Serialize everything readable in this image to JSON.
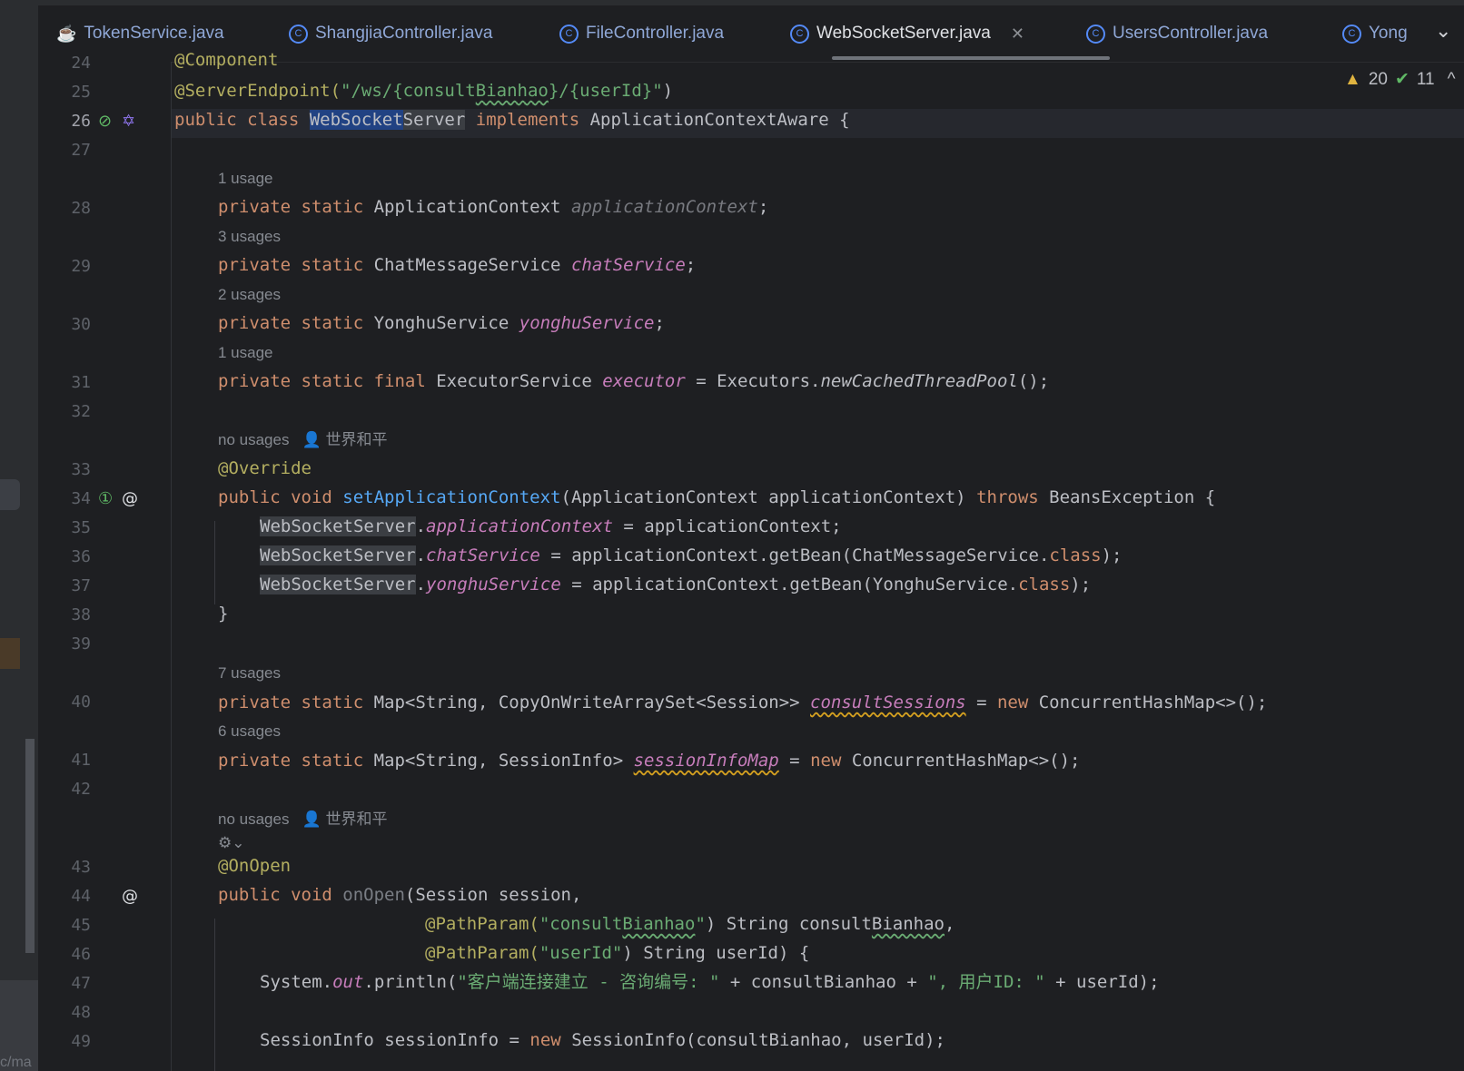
{
  "tabs": [
    {
      "label": "TokenService.java",
      "icon": "coffee-cup-icon"
    },
    {
      "label": "ShangjiaController.java",
      "icon": "class-icon"
    },
    {
      "label": "FileController.java",
      "icon": "class-icon"
    },
    {
      "label": "WebSocketServer.java",
      "icon": "class-icon",
      "active": true
    },
    {
      "label": "UsersController.java",
      "icon": "class-icon"
    },
    {
      "label": "Yong",
      "icon": "class-icon"
    }
  ],
  "inspection": {
    "warnings": "20",
    "ok": "11"
  },
  "sidebar_fragment": "c/ma",
  "line_numbers": {
    "l24": "24",
    "l25": "25",
    "l26": "26",
    "l27": "27",
    "l28": "28",
    "l29": "29",
    "l30": "30",
    "l31": "31",
    "l32": "32",
    "l33": "33",
    "l34": "34",
    "l35": "35",
    "l36": "36",
    "l37": "37",
    "l38": "38",
    "l39": "39",
    "l40": "40",
    "l41": "41",
    "l42": "42",
    "l43": "43",
    "l44": "44",
    "l45": "45",
    "l46": "46",
    "l47": "47",
    "l48": "48",
    "l49": "49"
  },
  "hints": {
    "h28": "1 usage",
    "h29": "3 usages",
    "h30": "2 usages",
    "h31": "1 usage",
    "h33": "no usages",
    "h40": "7 usages",
    "h41": "6 usages",
    "h43": "no usages",
    "author": "世界和平"
  },
  "code": {
    "l24_ann": "@Component",
    "l25_ann": "@ServerEndpoint(",
    "l25_str1": "\"/ws/{consult",
    "l25_str2": "Bianhao",
    "l25_str3": "}/{userId}\"",
    "l25_close": ")",
    "l26_kw": "public class ",
    "l26_sel": "WebSocket",
    "l26_ref": "Server",
    "l26_kw2": " implements ",
    "l26_rest": "ApplicationContextAware {",
    "l28_kw": "private static ",
    "l28_type": "ApplicationContext ",
    "l28_fld": "applicationContext",
    "l28_end": ";",
    "l29_kw": "private static ",
    "l29_type": "ChatMessageService ",
    "l29_fld": "chatService",
    "l29_end": ";",
    "l30_kw": "private static ",
    "l30_type": "YonghuService ",
    "l30_fld": "yonghuService",
    "l30_end": ";",
    "l31_kw": "private static final ",
    "l31_type": "ExecutorService ",
    "l31_fld": "executor",
    "l31_mid": " = Executors.",
    "l31_it": "newCachedThreadPool",
    "l31_end": "();",
    "l33_ann": "@Override",
    "l34_kw": "public void ",
    "l34_mth": "setApplicationContext",
    "l34_mid": "(ApplicationContext applicationContext) ",
    "l34_kw2": "throws ",
    "l34_end": "BeansException {",
    "l35_ref": "WebSocketServer",
    "l35_dot": ".",
    "l35_fld": "applicationContext",
    "l35_end": " = applicationContext;",
    "l36_ref": "WebSocketServer",
    "l36_dot": ".",
    "l36_fld": "chatService",
    "l36_mid": " = applicationContext.getBean(ChatMessageService.",
    "l36_kw": "class",
    "l36_end": ");",
    "l37_ref": "WebSocketServer",
    "l37_dot": ".",
    "l37_fld": "yonghuService",
    "l37_mid": " = applicationContext.getBean(YonghuService.",
    "l37_kw": "class",
    "l37_end": ");",
    "l38": "}",
    "l40_kw": "private static ",
    "l40_type": "Map<String, CopyOnWriteArraySet<Session>> ",
    "l40_fld": "consultSessions",
    "l40_mid": " = ",
    "l40_kw2": "new ",
    "l40_end": "ConcurrentHashMap<>();",
    "l41_kw": "private static ",
    "l41_type": "Map<String, SessionInfo> ",
    "l41_fld": "sessionInfoMap",
    "l41_mid": " = ",
    "l41_kw2": "new ",
    "l41_end": "ConcurrentHashMap<>();",
    "l43_ann": "@OnOpen",
    "l44_kw": "public void ",
    "l44_mth": "onOpen",
    "l44_end": "(Session session,",
    "l45_ann": "@PathParam(",
    "l45_str1": "\"consult",
    "l45_str2": "Bianhao",
    "l45_str3": "\"",
    "l45_mid": ") String consult",
    "l45_sq": "Bianhao",
    "l45_end": ",",
    "l46_ann": "@PathParam(",
    "l46_str": "\"userId\"",
    "l46_end": ") String userId) {",
    "l47_a": "System.",
    "l47_fld": "out",
    "l47_b": ".println(",
    "l47_str1": "\"客户端连接建立 - 咨询编号: \"",
    "l47_c": " + consultBianhao + ",
    "l47_str2": "\", 用户ID: \"",
    "l47_d": " + userId);",
    "l49_a": "SessionInfo sessionInfo = ",
    "l49_kw": "new ",
    "l49_b": "SessionInfo(consultBianhao, userId);"
  },
  "colors": {
    "background": "#1e1f22",
    "keyword": "#cf8e6d",
    "string": "#6aab73",
    "annotation": "#b3ae60",
    "field": "#c77dbb",
    "method": "#56a8f5"
  }
}
